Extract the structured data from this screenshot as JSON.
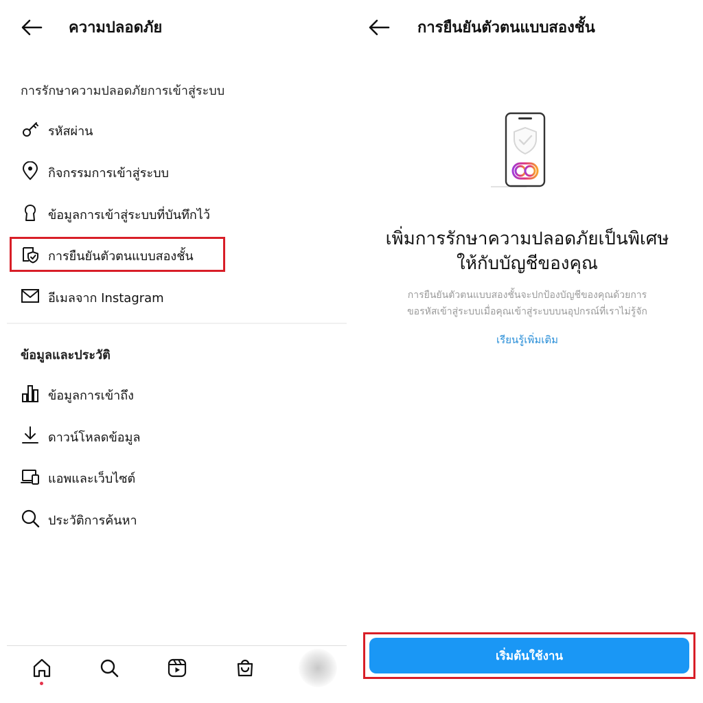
{
  "left": {
    "header": {
      "title": "ความปลอดภัย"
    },
    "sections": [
      {
        "title": "การรักษาความปลอดภัยการเข้าสู่ระบบ",
        "items": [
          {
            "label": "รหัสผ่าน",
            "icon": "key-icon"
          },
          {
            "label": "กิจกรรมการเข้าสู่ระบบ",
            "icon": "location-pin-icon"
          },
          {
            "label": "ข้อมูลการเข้าสู่ระบบที่บันทึกไว้",
            "icon": "keyhole-icon"
          },
          {
            "label": "การยืนยันตัวตนแบบสองชั้น",
            "icon": "shield-check-icon",
            "highlighted": true
          },
          {
            "label": "อีเมลจาก Instagram",
            "icon": "mail-icon"
          }
        ]
      },
      {
        "title": "ข้อมูลและประวัติ",
        "items": [
          {
            "label": "ข้อมูลการเข้าถึง",
            "icon": "bar-chart-icon"
          },
          {
            "label": "ดาวน์โหลดข้อมูล",
            "icon": "download-icon"
          },
          {
            "label": "แอพและเว็บไซต์",
            "icon": "laptop-icon"
          },
          {
            "label": "ประวัติการค้นหา",
            "icon": "search-icon"
          }
        ]
      }
    ],
    "bottom_nav": [
      "home-icon",
      "search-icon",
      "reels-icon",
      "shop-icon"
    ]
  },
  "right": {
    "header": {
      "title": "การยืนยันตัวตนแบบสองชั้น"
    },
    "illustration": "phone-shield-icon",
    "headline": [
      "เพิ่มการรักษาความปลอดภัยเป็นพิเศษ",
      "ให้กับบัญชีของคุณ"
    ],
    "description": [
      "การยืนยันตัวตนแบบสองชั้นจะปกป้องบัญชีของคุณด้วยการ",
      "ขอรหัสเข้าสู่ระบบเมื่อคุณเข้าสู่ระบบบนอุปกรณ์ที่เราไม่รู้จัก"
    ],
    "learn_more": "เรียนรู้เพิ่มเติม",
    "cta": "เริ่มต้นใช้งาน"
  },
  "colors": {
    "highlight_border": "#d81e27",
    "primary_button": "#1a97f5",
    "link": "#2a8fd8",
    "notification_dot": "#e5334b"
  }
}
